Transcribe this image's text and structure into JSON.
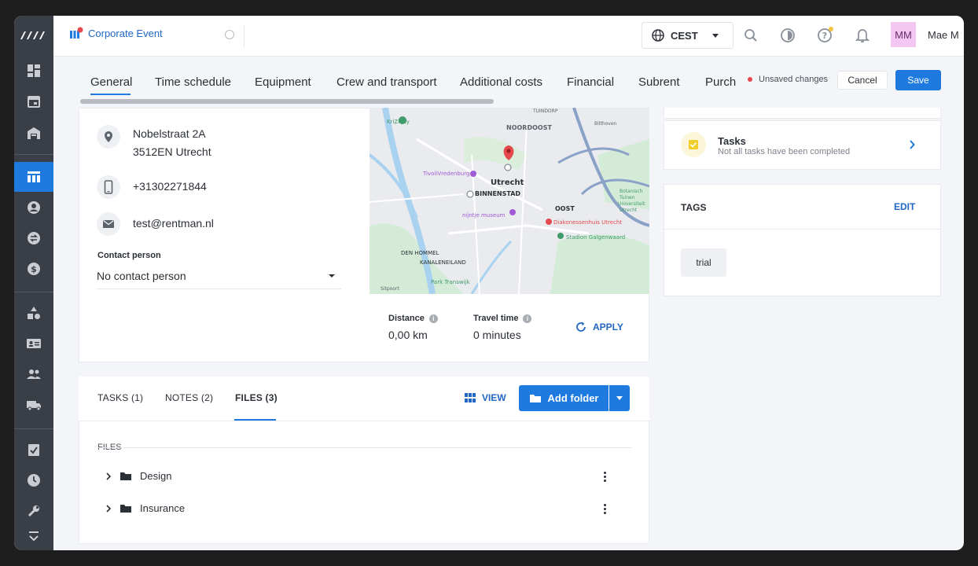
{
  "app": {
    "project_title": "Corporate Event"
  },
  "topbar": {
    "timezone": "CEST",
    "avatar_initials": "MM",
    "user_name": "Mae M"
  },
  "tabs": [
    {
      "label": "General",
      "active": true
    },
    {
      "label": "Time schedule"
    },
    {
      "label": "Equipment"
    },
    {
      "label": "Crew and transport"
    },
    {
      "label": "Additional costs"
    },
    {
      "label": "Financial"
    },
    {
      "label": "Subrent"
    },
    {
      "label": "Purch"
    }
  ],
  "actions": {
    "unsaved": "Unsaved changes",
    "cancel": "Cancel",
    "save": "Save"
  },
  "location": {
    "address_line1": "Nobelstraat 2A",
    "address_line2": "3512EN Utrecht",
    "phone": "+31302271844",
    "email": "test@rentman.nl",
    "contact_label": "Contact person",
    "contact_value": "No contact person"
  },
  "map": {
    "labels": [
      "NOORDOOST",
      "Utrecht",
      "BINNENSTAD",
      "OOST",
      "DEN HOMMEL",
      "KANALENEILAND",
      "Park Transwijk",
      "TivoliVredenburg",
      "nijntje museum",
      "Diakonessenhuis Utrecht",
      "Stadion Galgenwaard",
      "TUINDORP",
      "KriZicity",
      "Botanisch Tuinen Universiteit Utrecht",
      "Bilthoven",
      "Sitpoort"
    ]
  },
  "travel": {
    "distance_label": "Distance",
    "distance_value": "0,00 km",
    "time_label": "Travel time",
    "time_value": "0 minutes",
    "apply": "APPLY"
  },
  "files_card": {
    "tabs": [
      "TASKS (1)",
      "NOTES (2)",
      "FILES (3)"
    ],
    "active_tab": "FILES (3)",
    "view": "VIEW",
    "add_folder": "Add folder",
    "section": "FILES",
    "folders": [
      "Design",
      "Insurance"
    ]
  },
  "tasks_panel": {
    "title": "Tasks",
    "subtitle": "Not all tasks have been completed"
  },
  "tags_panel": {
    "title": "TAGS",
    "edit": "EDIT",
    "tags": [
      "trial"
    ]
  },
  "colors": {
    "accent": "#1f7ae0",
    "sidebar": "#3a3f47",
    "unsaved_dot": "#e5484d",
    "avatar_bg": "#f2c8f2"
  }
}
